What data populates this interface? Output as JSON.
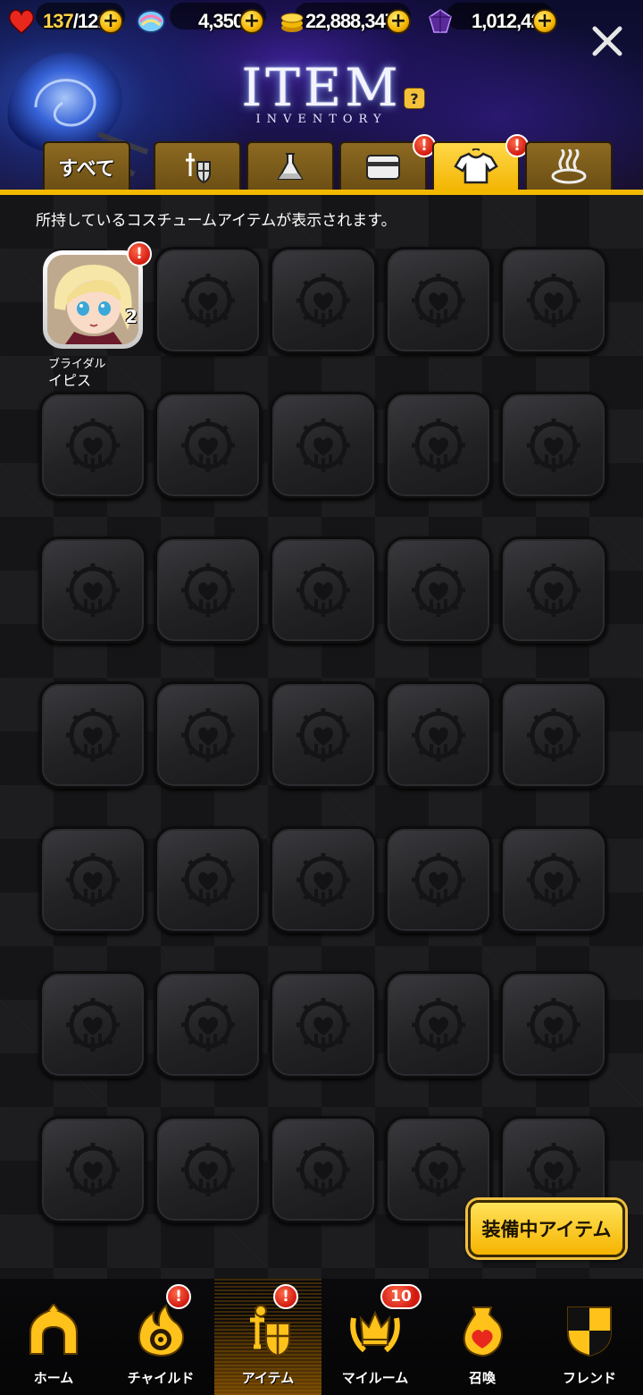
{
  "stats": {
    "hp": "137",
    "hp_max": "/121",
    "crystals": "4,350",
    "gold": "22,888,347",
    "gems": "1,012,421"
  },
  "header": {
    "title": "ITEM",
    "subtitle": "INVENTORY",
    "help": "?"
  },
  "tabs": [
    {
      "label": "すべて",
      "icon": "all",
      "badge": ""
    },
    {
      "label": "",
      "icon": "equipment-icon",
      "badge": ""
    },
    {
      "label": "",
      "icon": "potion-flask-icon",
      "badge": ""
    },
    {
      "label": "",
      "icon": "card-icon",
      "badge": "!"
    },
    {
      "label": "",
      "icon": "costume-shirt-icon",
      "badge": "!"
    },
    {
      "label": "",
      "icon": "hot-spring-icon",
      "badge": ""
    }
  ],
  "main": {
    "info": "所持しているコスチュームアイテムが表示されます。",
    "item": {
      "name_line1": "ブライダル",
      "name_line2": "イピス",
      "count": "2",
      "badge": "!"
    },
    "equipped_button": "装備中アイテム"
  },
  "nav": [
    {
      "label": "ホーム",
      "icon": "home-icon",
      "badge": ""
    },
    {
      "label": "チャイルド",
      "icon": "child-flame-icon",
      "badge": "!"
    },
    {
      "label": "アイテム",
      "icon": "item-knight-icon",
      "badge": "!"
    },
    {
      "label": "マイルーム",
      "icon": "crown-laurel-icon",
      "badge": "10"
    },
    {
      "label": "召喚",
      "icon": "summon-potion-icon",
      "badge": ""
    },
    {
      "label": "フレンド",
      "icon": "shield-icon",
      "badge": ""
    }
  ],
  "colors": {
    "accent": "#f3b800",
    "badge": "#d21a10",
    "tab_inactive": "#8d6a22"
  }
}
